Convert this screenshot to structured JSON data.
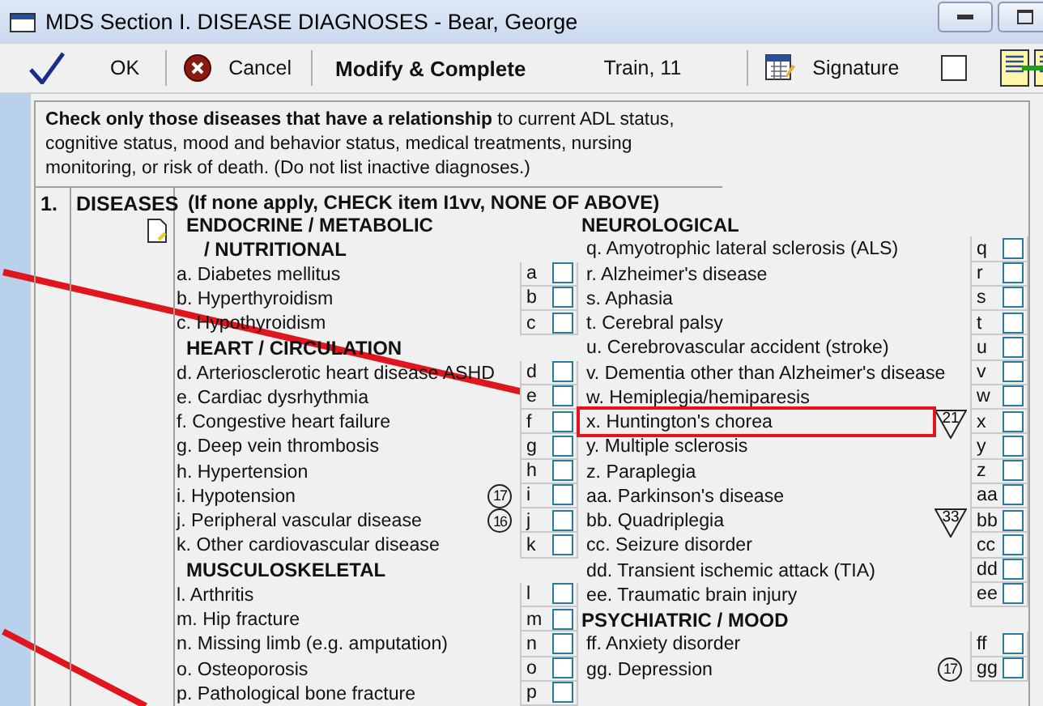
{
  "window": {
    "title": "MDS Section I. DISEASE DIAGNOSES - Bear, George"
  },
  "toolbar": {
    "ok": "OK",
    "cancel": "Cancel",
    "mode": "Modify & Complete",
    "user": "Train, 11",
    "signature": "Signature",
    "signature_checked": false
  },
  "instructions": "**Check only those diseases that have a relationship** to current ADL status, cognitive status, mood and behavior status, medical treatments, nursing monitoring, or risk of death. (Do not list inactive diagnoses.)",
  "section": {
    "number": "1.",
    "title": "DISEASES",
    "note": "(If none apply, CHECK item I1vv, NONE OF ABOVE)"
  },
  "columns": [
    {
      "rows": [
        {
          "kind": "heading",
          "text": "ENDOCRINE / METABOLIC"
        },
        {
          "kind": "subheading",
          "text": "/ NUTRITIONAL"
        },
        {
          "kind": "item",
          "text": "a. Diabetes mellitus",
          "code": "a",
          "checked": false,
          "highlighted": false
        },
        {
          "kind": "item",
          "text": "b. Hyperthyroidism",
          "code": "b",
          "checked": false,
          "highlighted": false
        },
        {
          "kind": "item",
          "text": "c. Hypothyroidism",
          "code": "c",
          "checked": false,
          "highlighted": false
        },
        {
          "kind": "heading",
          "text": "HEART / CIRCULATION"
        },
        {
          "kind": "item",
          "text": "d. Arteriosclerotic heart disease ASHD",
          "code": "d",
          "checked": false,
          "highlighted": false
        },
        {
          "kind": "item",
          "text": "e. Cardiac dysrhythmia",
          "code": "e",
          "checked": false,
          "highlighted": false
        },
        {
          "kind": "item",
          "text": "f. Congestive heart failure",
          "code": "f",
          "checked": false,
          "highlighted": false
        },
        {
          "kind": "item",
          "text": "g. Deep vein thrombosis",
          "code": "g",
          "checked": false,
          "highlighted": false
        },
        {
          "kind": "item",
          "text": "h. Hypertension",
          "code": "h",
          "checked": false,
          "highlighted": false
        },
        {
          "kind": "item",
          "text": "i. Hypotension",
          "code": "i",
          "checked": false,
          "highlighted": false,
          "marker": {
            "kind": "circle",
            "text": "17"
          }
        },
        {
          "kind": "item",
          "text": "j. Peripheral vascular disease",
          "code": "j",
          "checked": false,
          "highlighted": false,
          "marker": {
            "kind": "circle",
            "text": "16"
          }
        },
        {
          "kind": "item",
          "text": "k. Other cardiovascular disease",
          "code": "k",
          "checked": false,
          "highlighted": false
        },
        {
          "kind": "heading",
          "text": "MUSCULOSKELETAL"
        },
        {
          "kind": "item",
          "text": "l. Arthritis",
          "code": "l",
          "checked": false,
          "highlighted": false
        },
        {
          "kind": "item",
          "text": "m. Hip fracture",
          "code": "m",
          "checked": false,
          "highlighted": false
        },
        {
          "kind": "item",
          "text": "n. Missing limb (e.g. amputation)",
          "code": "n",
          "checked": false,
          "highlighted": false
        },
        {
          "kind": "item",
          "text": "o. Osteoporosis",
          "code": "o",
          "checked": false,
          "highlighted": false
        },
        {
          "kind": "item",
          "text": "p. Pathological bone fracture",
          "code": "p",
          "checked": false,
          "highlighted": false
        }
      ]
    },
    {
      "rows": [
        {
          "kind": "heading",
          "text": "NEUROLOGICAL"
        },
        {
          "kind": "item",
          "text": "q. Amyotrophic lateral sclerosis (ALS)",
          "code": "q",
          "checked": false,
          "highlighted": false
        },
        {
          "kind": "item",
          "text": "r. Alzheimer's disease",
          "code": "r",
          "checked": false,
          "highlighted": false
        },
        {
          "kind": "item",
          "text": "s. Aphasia",
          "code": "s",
          "checked": false,
          "highlighted": false
        },
        {
          "kind": "item",
          "text": "t. Cerebral palsy",
          "code": "t",
          "checked": false,
          "highlighted": false
        },
        {
          "kind": "item",
          "text": "u. Cerebrovascular accident (stroke)",
          "code": "u",
          "checked": false,
          "highlighted": false
        },
        {
          "kind": "item",
          "text": "v. Dementia other than Alzheimer's disease",
          "code": "v",
          "checked": false,
          "highlighted": false
        },
        {
          "kind": "item",
          "text": "w. Hemiplegia/hemiparesis",
          "code": "w",
          "checked": false,
          "highlighted": false
        },
        {
          "kind": "item",
          "text": "x. Huntington's chorea",
          "code": "x",
          "checked": false,
          "highlighted": true,
          "marker": {
            "kind": "triangle",
            "text": "21"
          }
        },
        {
          "kind": "item",
          "text": "y. Multiple sclerosis",
          "code": "y",
          "checked": false,
          "highlighted": false
        },
        {
          "kind": "item",
          "text": "z. Paraplegia",
          "code": "z",
          "checked": false,
          "highlighted": false
        },
        {
          "kind": "item",
          "text": "aa. Parkinson's disease",
          "code": "aa",
          "checked": false,
          "highlighted": false
        },
        {
          "kind": "item",
          "text": "bb. Quadriplegia",
          "code": "bb",
          "checked": false,
          "highlighted": false,
          "marker": {
            "kind": "triangle",
            "text": "33"
          }
        },
        {
          "kind": "item",
          "text": "cc. Seizure disorder",
          "code": "cc",
          "checked": false,
          "highlighted": false
        },
        {
          "kind": "item",
          "text": "dd. Transient ischemic attack (TIA)",
          "code": "dd",
          "checked": false,
          "highlighted": false
        },
        {
          "kind": "item",
          "text": "ee. Traumatic brain injury",
          "code": "ee",
          "checked": false,
          "highlighted": false
        },
        {
          "kind": "heading",
          "text": "PSYCHIATRIC / MOOD"
        },
        {
          "kind": "item",
          "text": "ff. Anxiety disorder",
          "code": "ff",
          "checked": false,
          "highlighted": false
        },
        {
          "kind": "item",
          "text": "gg. Depression",
          "code": "gg",
          "checked": false,
          "highlighted": false,
          "marker": {
            "kind": "circle",
            "text": "17"
          }
        }
      ]
    }
  ]
}
